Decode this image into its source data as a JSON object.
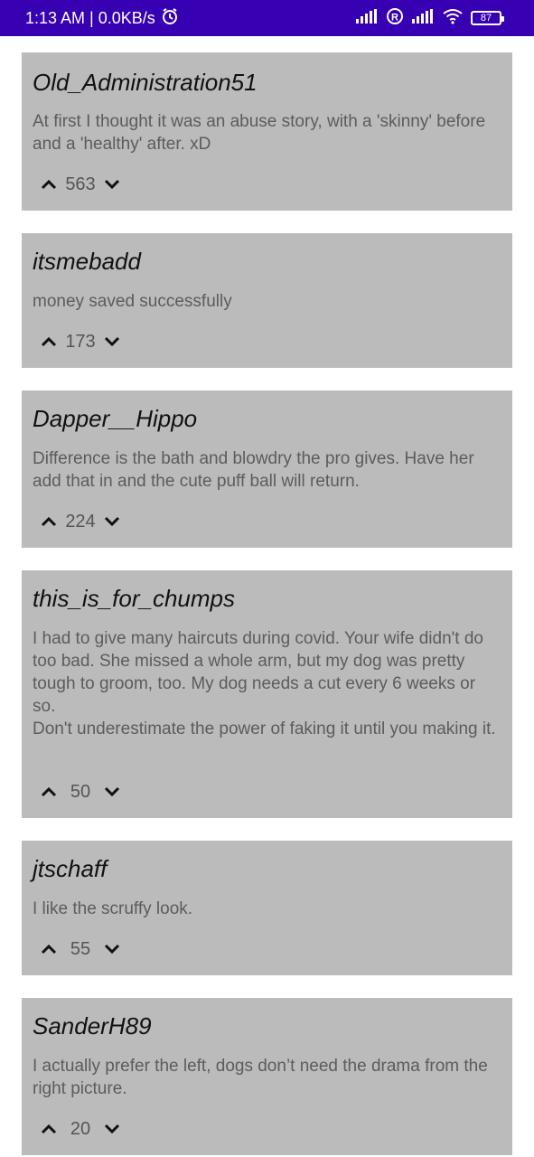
{
  "status_bar": {
    "time_speed": "1:13 AM | 0.0KB/s",
    "battery": "87",
    "icons": [
      "alarm-icon",
      "signal-icon",
      "registered-icon",
      "signal-icon",
      "wifi-icon",
      "battery-icon"
    ]
  },
  "comments": [
    {
      "author": "Old_Administration51",
      "body": "At first I thought it was an abuse story, with a 'skinny' before and a 'healthy' after. xD",
      "score": "563"
    },
    {
      "author": "itsmebadd",
      "body": "money saved successfully",
      "score": "173"
    },
    {
      "author": "Dapper__Hippo",
      "body": "Difference is the bath and blowdry the pro gives. Have her add that in and the cute puff ball will return.",
      "score": "224"
    },
    {
      "author": "this_is_for_chumps",
      "body": "I had to give many haircuts during covid. Your wife didn't do too bad. She missed a whole arm, but my dog was pretty tough to groom, too. My dog needs a cut every 6 weeks or so.\nDon't underestimate the power of faking it until you making it.",
      "score": "50"
    },
    {
      "author": "jtschaff",
      "body": "I like the scruffy look.",
      "score": "55"
    },
    {
      "author": "SanderH89",
      "body": "I actually prefer the left, dogs don’t need the drama from the right picture.",
      "score": "20"
    }
  ]
}
